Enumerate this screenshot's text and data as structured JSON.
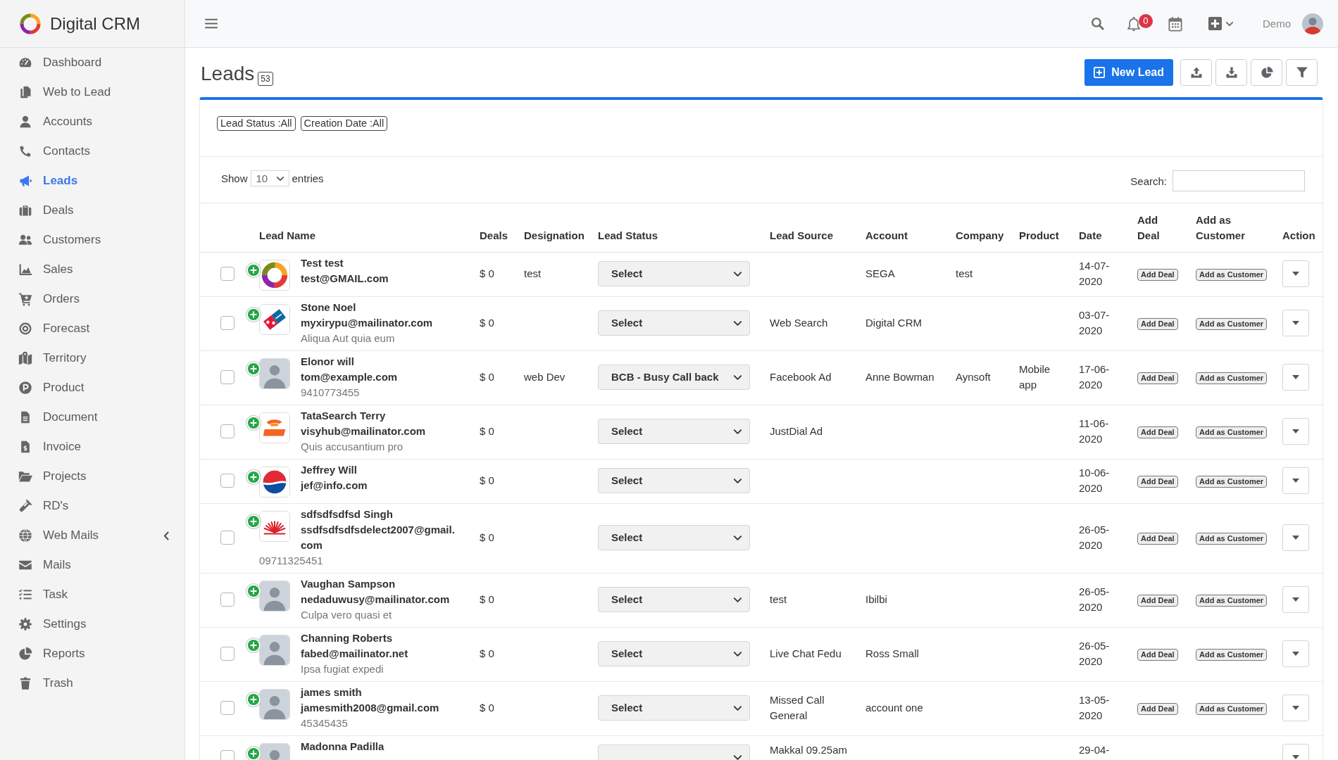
{
  "sidebar": {
    "brand": "Digital CRM",
    "items": [
      {
        "label": "Dashboard",
        "selected": false,
        "submenu": false
      },
      {
        "label": "Web to Lead",
        "selected": false,
        "submenu": false
      },
      {
        "label": "Accounts",
        "selected": false,
        "submenu": false
      },
      {
        "label": "Contacts",
        "selected": false,
        "submenu": false
      },
      {
        "label": "Leads",
        "selected": true,
        "submenu": false
      },
      {
        "label": "Deals",
        "selected": false,
        "submenu": false
      },
      {
        "label": "Customers",
        "selected": false,
        "submenu": false
      },
      {
        "label": "Sales",
        "selected": false,
        "submenu": false
      },
      {
        "label": "Orders",
        "selected": false,
        "submenu": false
      },
      {
        "label": "Forecast",
        "selected": false,
        "submenu": false
      },
      {
        "label": "Territory",
        "selected": false,
        "submenu": false
      },
      {
        "label": "Product",
        "selected": false,
        "submenu": false
      },
      {
        "label": "Document",
        "selected": false,
        "submenu": false
      },
      {
        "label": "Invoice",
        "selected": false,
        "submenu": false
      },
      {
        "label": "Projects",
        "selected": false,
        "submenu": false
      },
      {
        "label": "RD's",
        "selected": false,
        "submenu": false
      },
      {
        "label": "Web Mails",
        "selected": false,
        "submenu": true
      },
      {
        "label": "Mails",
        "selected": false,
        "submenu": false
      },
      {
        "label": "Task",
        "selected": false,
        "submenu": false
      },
      {
        "label": "Settings",
        "selected": false,
        "submenu": false
      },
      {
        "label": "Reports",
        "selected": false,
        "submenu": false
      },
      {
        "label": "Trash",
        "selected": false,
        "submenu": false
      }
    ]
  },
  "topbar": {
    "notifications": "0",
    "user": "Demo"
  },
  "header": {
    "title": "Leads",
    "count": "53",
    "new_button": "New Lead"
  },
  "filters": [
    "Lead Status :All",
    "Creation Date :All"
  ],
  "length_menu": {
    "before": "Show",
    "value": "10",
    "after": "entries"
  },
  "search": {
    "label": "Search:"
  },
  "table": {
    "columns": [
      "Lead Name",
      "Deals",
      "Designation",
      "Lead Status",
      "Lead Source",
      "Account",
      "Company",
      "Product",
      "Date",
      "Add Deal",
      "Add as Customer",
      "Action"
    ],
    "rows": [
      {
        "checked": false,
        "avatar": {
          "kind": "ring"
        },
        "name": "Test test",
        "email": "test@GMAIL.com",
        "deals": "$ 0",
        "designation": "test",
        "lead_status": "Select",
        "account": "SEGA",
        "company": "test",
        "date": "14-07-2020",
        "add_deal": "Add Deal",
        "add_customer": "Add as Customer"
      },
      {
        "checked": false,
        "avatar": {
          "kind": "tile"
        },
        "name": "Stone Noel",
        "email": "myxirypu@mailinator.com",
        "note": "Aliqua Aut quia eum",
        "deals": "$ 0",
        "lead_status": "Select",
        "lead_source": "Web Search",
        "account": "Digital CRM",
        "date": "03-07-2020",
        "add_deal": "Add Deal",
        "add_customer": "Add as Customer"
      },
      {
        "checked": false,
        "avatar": {
          "kind": "person"
        },
        "name": "Elonor will",
        "email": "tom@example.com",
        "note": "9410773455",
        "deals": "$ 0",
        "designation": "web Dev",
        "lead_status": "BCB - Busy Call back",
        "lead_source": "Facebook Ad",
        "account": "Anne Bowman",
        "company": "Aynsoft",
        "product": "Mobile app",
        "date": "17-06-2020",
        "add_deal": "Add Deal",
        "add_customer": "Add as Customer"
      },
      {
        "checked": false,
        "avatar": {
          "kind": "swoosh"
        },
        "name": "TataSearch Terry",
        "email": "visyhub@mailinator.com",
        "note": "Quis accusantium pro",
        "deals": "$ 0",
        "lead_status": "Select",
        "lead_source": "JustDial Ad",
        "date": "11-06-2020",
        "add_deal": "Add Deal",
        "add_customer": "Add as Customer"
      },
      {
        "checked": false,
        "avatar": {
          "kind": "sphere"
        },
        "name": "Jeffrey Will",
        "email": "jef@info.com",
        "deals": "$ 0",
        "lead_status": "Select",
        "date": "10-06-2020",
        "add_deal": "Add Deal",
        "add_customer": "Add as Customer"
      },
      {
        "checked": false,
        "avatar": {
          "kind": "fan"
        },
        "name": "sdfsdfsdfsd Singh",
        "email": "ssdfsdfsdfsdelect2007@gmail.com",
        "note": "09711325451",
        "deals": "$ 0",
        "lead_status": "Select",
        "date": "26-05-2020",
        "add_deal": "Add Deal",
        "add_customer": "Add as Customer"
      },
      {
        "checked": false,
        "avatar": {
          "kind": "person"
        },
        "name": "Vaughan Sampson",
        "email": "nedaduwusy@mailinator.com",
        "note": "Culpa vero quasi et",
        "deals": "$ 0",
        "lead_status": "Select",
        "lead_source": "test",
        "account": "Ibilbi",
        "date": "26-05-2020",
        "add_deal": "Add Deal",
        "add_customer": "Add as Customer"
      },
      {
        "checked": false,
        "avatar": {
          "kind": "person"
        },
        "name": "Channing Roberts",
        "email": "fabed@mailinator.net",
        "note": "Ipsa fugiat expedi",
        "deals": "$ 0",
        "lead_status": "Select",
        "lead_source": "Live Chat Fedu",
        "account": "Ross Small",
        "date": "26-05-2020",
        "add_deal": "Add Deal",
        "add_customer": "Add as Customer"
      },
      {
        "checked": false,
        "avatar": {
          "kind": "person"
        },
        "name": "james smith",
        "email": "jamesmith2008@gmail.com",
        "note": "45345435",
        "deals": "$ 0",
        "lead_status": "Select",
        "lead_source": "Missed Call General",
        "account": "account one",
        "date": "13-05-2020",
        "add_deal": "Add Deal",
        "add_customer": "Add as Customer"
      },
      {
        "checked": false,
        "avatar": {
          "kind": "person"
        },
        "name": "Madonna Padilla",
        "lead_source": "Makkal 09.25am",
        "date": "29-04-"
      }
    ]
  }
}
